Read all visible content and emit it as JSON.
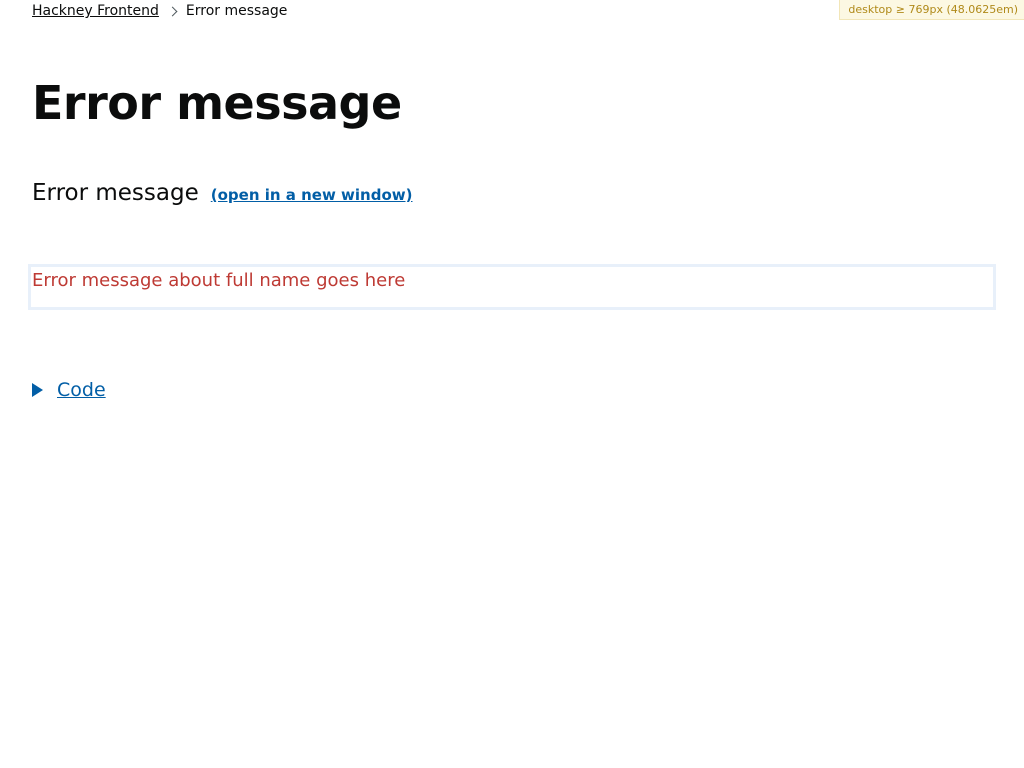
{
  "media_query_badge": "desktop ≥ 769px (48.0625em)",
  "breadcrumb": {
    "items": [
      {
        "label": "Hackney Frontend"
      },
      {
        "label": "Error message"
      }
    ]
  },
  "page": {
    "title": "Error message"
  },
  "example": {
    "heading": "Error message",
    "open_link": "(open in a new window)",
    "error_text": "Error message about full name goes here"
  },
  "details": {
    "summary": "Code"
  },
  "colors": {
    "link": "#025ea6",
    "error": "#be3a34",
    "text": "#0b0c0c"
  }
}
